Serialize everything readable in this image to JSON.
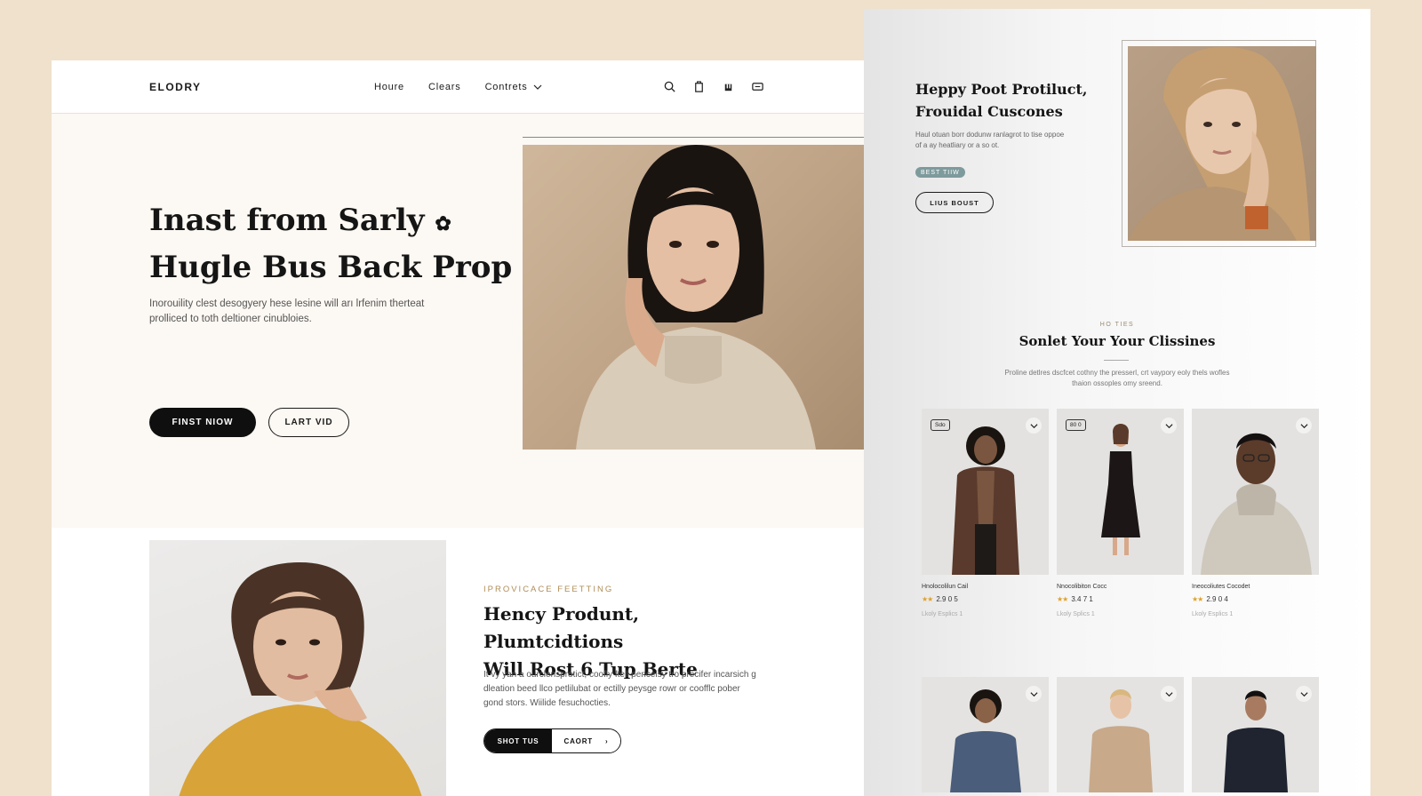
{
  "nav": {
    "logo": "ΕLODRY",
    "links": [
      "Houre",
      "Clears",
      "Contrets"
    ],
    "icons": [
      "search-icon",
      "bag-icon",
      "account-icon",
      "cart-icon"
    ]
  },
  "hero": {
    "title_line1": "Inast from Sarly",
    "title_line2": "Hugle Bus Back Prop",
    "text": "Inorouility clest desogyery hese lesine will arı lrfenim therteat prolliced to toth deltioner cinubloies.",
    "primary_button": "FINST NIOW",
    "secondary_button": "LART VID"
  },
  "feature": {
    "eyebrow": "IPROVICACE FEETTING",
    "title_line1": "Hency Produnt, Plumtcidtions",
    "title_line2": "Will Rost 6 Tup Berte",
    "text": "It vy yan a ourclensprotict, coofly ftell pencelsy tro precifer incarsich g dleation beed llco petlilubat or ectilly peysge rowr or coofflc pober gond stors. Wiilide fesuchocties.",
    "button_left": "SHOT TUS",
    "button_right": "CAORT"
  },
  "right": {
    "title_line1": "Heppy Poot Protiluct,",
    "title_line2": "Frouidal Cuscones",
    "text": "Haul otuan borr dodunw ranlagrot to tise oppoe of a ay heatliary or a so ot.",
    "badge": "BEST TIIW",
    "button": "LIUS BOUST"
  },
  "section": {
    "eyebrow": "HO TIES",
    "title": "Sonlet Your Your Clissines",
    "text": "Proline detlres dscfcet cothny the presserl, crt vaypory eoly thels wofles thaion ossoples omy sreend."
  },
  "products": [
    {
      "tag": "Sdo",
      "name": "Hnolocolilun Cail",
      "rating": "2.9 0 5",
      "meta": "Lkoly Esplics 1",
      "color": "#5a3a2c"
    },
    {
      "tag": "80 0",
      "name": "Nnocolibiton Cocc",
      "rating": "3.4 7 1",
      "meta": "Lkoly Splics 1",
      "color": "#1c1616"
    },
    {
      "tag": "",
      "name": "Ineocoliutes Cocodet",
      "rating": "2.9 0 4",
      "meta": "Lkoly Esplics 1",
      "color": "#cfc8bd"
    }
  ],
  "products_row2": [
    {
      "color": "#4a5d7a"
    },
    {
      "color": "#c8a98a"
    },
    {
      "color": "#1f2430"
    }
  ]
}
